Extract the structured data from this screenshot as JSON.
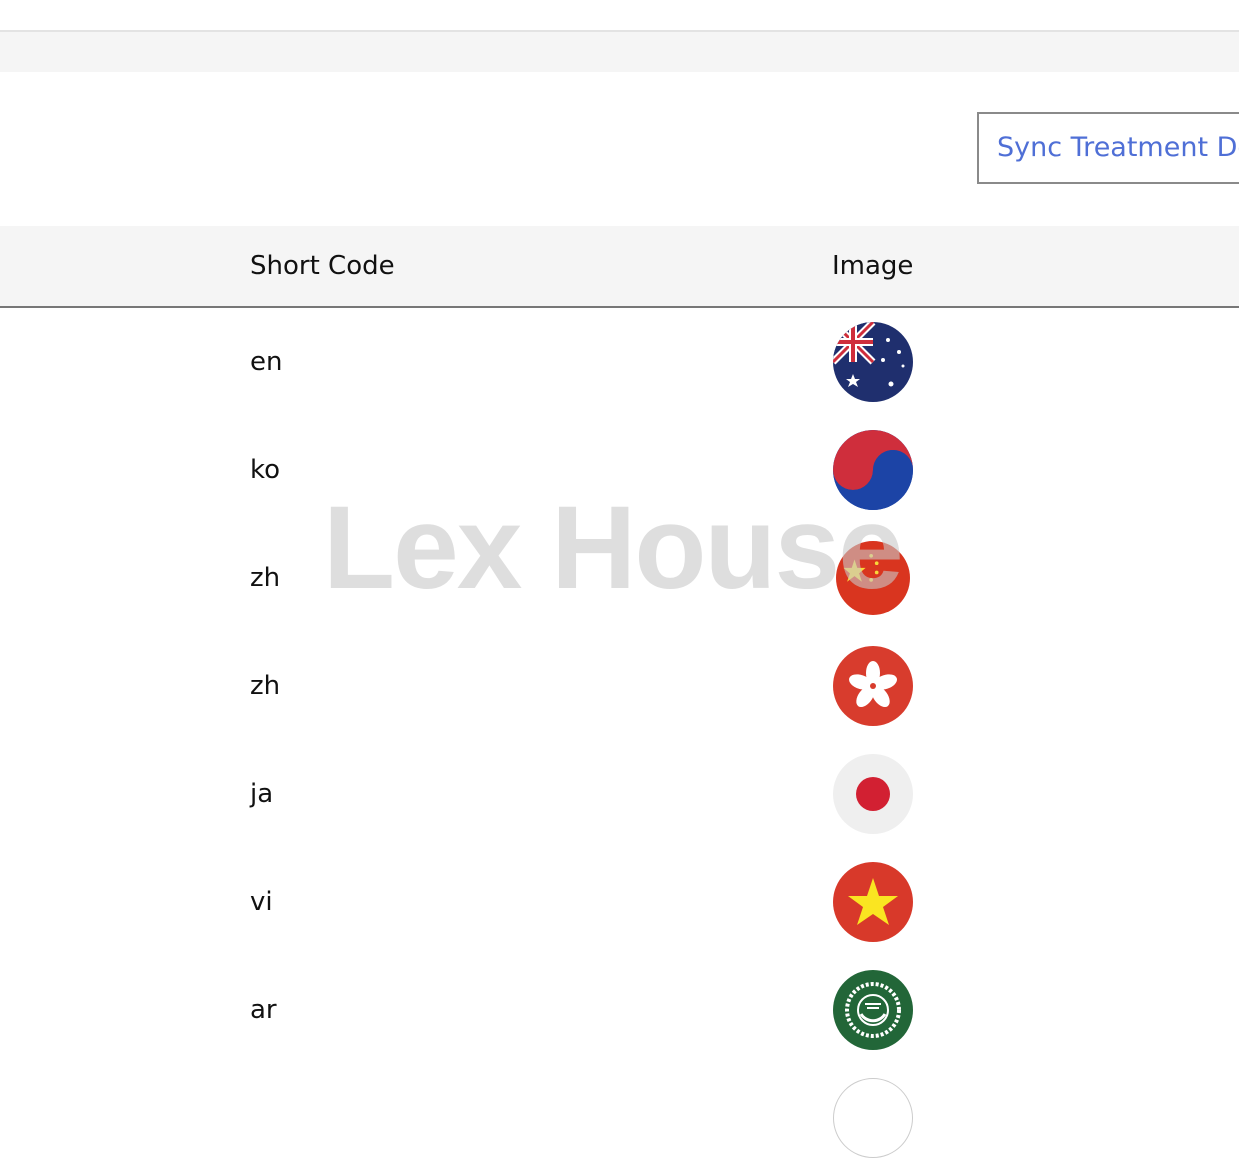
{
  "toolbar": {
    "sync_label": "Sync Treatment De"
  },
  "table": {
    "headers": {
      "short_code": "Short Code",
      "image": "Image"
    },
    "rows": [
      {
        "code": "en",
        "flag": "australia-flag-icon"
      },
      {
        "code": "ko",
        "flag": "korea-flag-icon"
      },
      {
        "code": "zh",
        "flag": "china-flag-icon"
      },
      {
        "code": "zh",
        "flag": "hong-kong-flag-icon"
      },
      {
        "code": "ja",
        "flag": "japan-flag-icon"
      },
      {
        "code": "vi",
        "flag": "vietnam-flag-icon"
      },
      {
        "code": "ar",
        "flag": "arab-league-flag-icon"
      }
    ]
  },
  "watermark": "Lex House",
  "colors": {
    "accent": "#4f6fd6",
    "header_bg": "#f5f5f5"
  }
}
